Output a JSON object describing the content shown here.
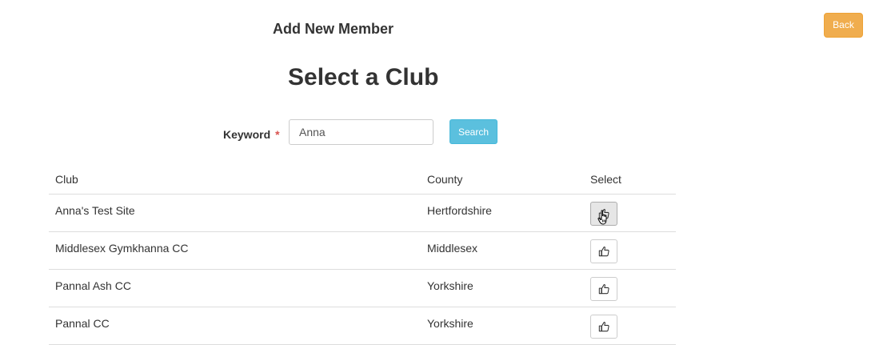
{
  "header": {
    "title": "Add New Member",
    "back_label": "Back"
  },
  "main": {
    "section_title": "Select a Club",
    "keyword_label": "Keyword",
    "required_marker": "*",
    "keyword_value": "Anna",
    "search_label": "Search"
  },
  "table": {
    "columns": [
      "Club",
      "County",
      "Select"
    ],
    "rows": [
      {
        "club": "Anna's Test Site",
        "county": "Hertfordshire",
        "select_icon": "thumbs-up-icon",
        "active": true
      },
      {
        "club": "Middlesex Gymkhanna CC",
        "county": "Middlesex",
        "select_icon": "thumbs-up-icon",
        "active": false
      },
      {
        "club": "Pannal Ash CC",
        "county": "Yorkshire",
        "select_icon": "thumbs-up-icon",
        "active": false
      },
      {
        "club": "Pannal CC",
        "county": "Yorkshire",
        "select_icon": "thumbs-up-icon",
        "active": false
      }
    ]
  },
  "colors": {
    "back_button": "#f0ad4e",
    "search_button": "#5bc0de",
    "required_star": "#d9534f",
    "text": "#333333",
    "row_border": "#dddddd"
  }
}
